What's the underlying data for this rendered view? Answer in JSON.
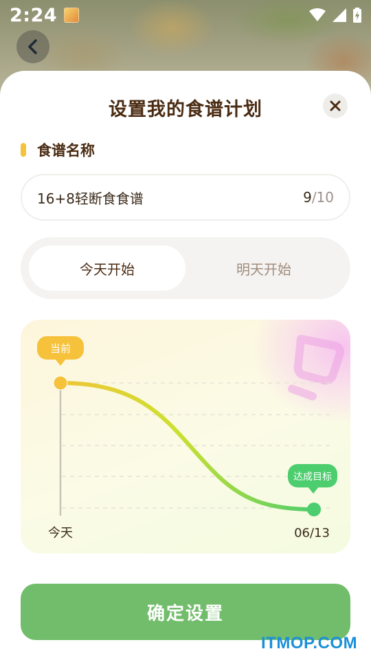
{
  "status_bar": {
    "time": "2:24",
    "icons": [
      "app-notification-icon",
      "wifi-icon",
      "signal-icon",
      "battery-icon"
    ]
  },
  "header": {
    "back_icon": "chevron-left-icon"
  },
  "sheet": {
    "title": "设置我的食谱计划",
    "close_icon": "close-icon"
  },
  "recipe_name": {
    "label": "食谱名称",
    "value": "16+8轻断食食谱",
    "count": "9",
    "max": "/10"
  },
  "start_toggle": {
    "options": [
      "今天开始",
      "明天开始"
    ],
    "selected": "今天开始"
  },
  "chart": {
    "tag_current": "当前",
    "tag_target": "达成目标",
    "start_label": "今天",
    "end_label": "06/13"
  },
  "confirm_button": "确定设置",
  "watermark": "ITMOP.COM",
  "colors": {
    "accent_yellow": "#f6c13b",
    "accent_green": "#4ccd6e",
    "button_green": "#72bd6b",
    "title_brown": "#4a2b12"
  }
}
